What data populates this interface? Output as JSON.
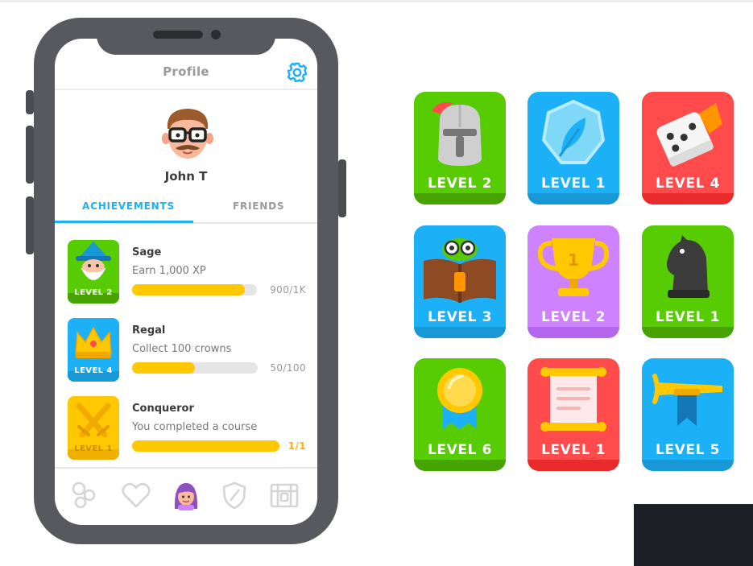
{
  "screen": {
    "title": "Profile"
  },
  "user": {
    "name": "John T"
  },
  "tabs": [
    {
      "label": "ACHIEVEMENTS",
      "active": true
    },
    {
      "label": "FRIENDS",
      "active": false
    }
  ],
  "achievements": [
    {
      "title": "Sage",
      "description": "Earn 1,000 XP",
      "level": "LEVEL 2",
      "progress_text": "900/1K",
      "progress": 0.9,
      "color": "#58cc02",
      "icon": "wizard-icon"
    },
    {
      "title": "Regal",
      "description": "Collect 100 crowns",
      "level": "LEVEL 4",
      "progress_text": "50/100",
      "progress": 0.5,
      "color": "#1cb0f6",
      "icon": "crown-icon"
    },
    {
      "title": "Conqueror",
      "description": "You completed a course",
      "level": "LEVEL 1",
      "progress_text": "1/1",
      "progress": 1.0,
      "color": "#ffc800",
      "icon": "crossed-swords-icon"
    }
  ],
  "nav": [
    {
      "icon": "learn-bubbles-icon"
    },
    {
      "icon": "heart-icon"
    },
    {
      "icon": "profile-avatar-icon",
      "active": true
    },
    {
      "icon": "shield-icon"
    },
    {
      "icon": "shop-chest-icon"
    }
  ],
  "badges": [
    {
      "label": "LEVEL 2",
      "color": "#58cc02",
      "icon": "knight-helmet-icon"
    },
    {
      "label": "LEVEL 1",
      "color": "#1cb0f6",
      "icon": "feather-gem-icon"
    },
    {
      "label": "LEVEL 4",
      "color": "#ff4b4b",
      "icon": "dice-icon"
    },
    {
      "label": "LEVEL 3",
      "color": "#1cb0f6",
      "icon": "owl-reading-book-icon"
    },
    {
      "label": "LEVEL 2",
      "color": "#ce82ff",
      "icon": "trophy-icon"
    },
    {
      "label": "LEVEL 1",
      "color": "#58cc02",
      "icon": "chess-knight-icon"
    },
    {
      "label": "LEVEL 6",
      "color": "#58cc02",
      "icon": "medal-icon"
    },
    {
      "label": "LEVEL 1",
      "color": "#ff4b4b",
      "icon": "scroll-icon"
    },
    {
      "label": "LEVEL 5",
      "color": "#1cb0f6",
      "icon": "trumpet-icon"
    }
  ],
  "colors": {
    "accent_blue": "#1cb0f6",
    "progress_yellow": "#ffc800",
    "phone_frame": "#58595e"
  }
}
